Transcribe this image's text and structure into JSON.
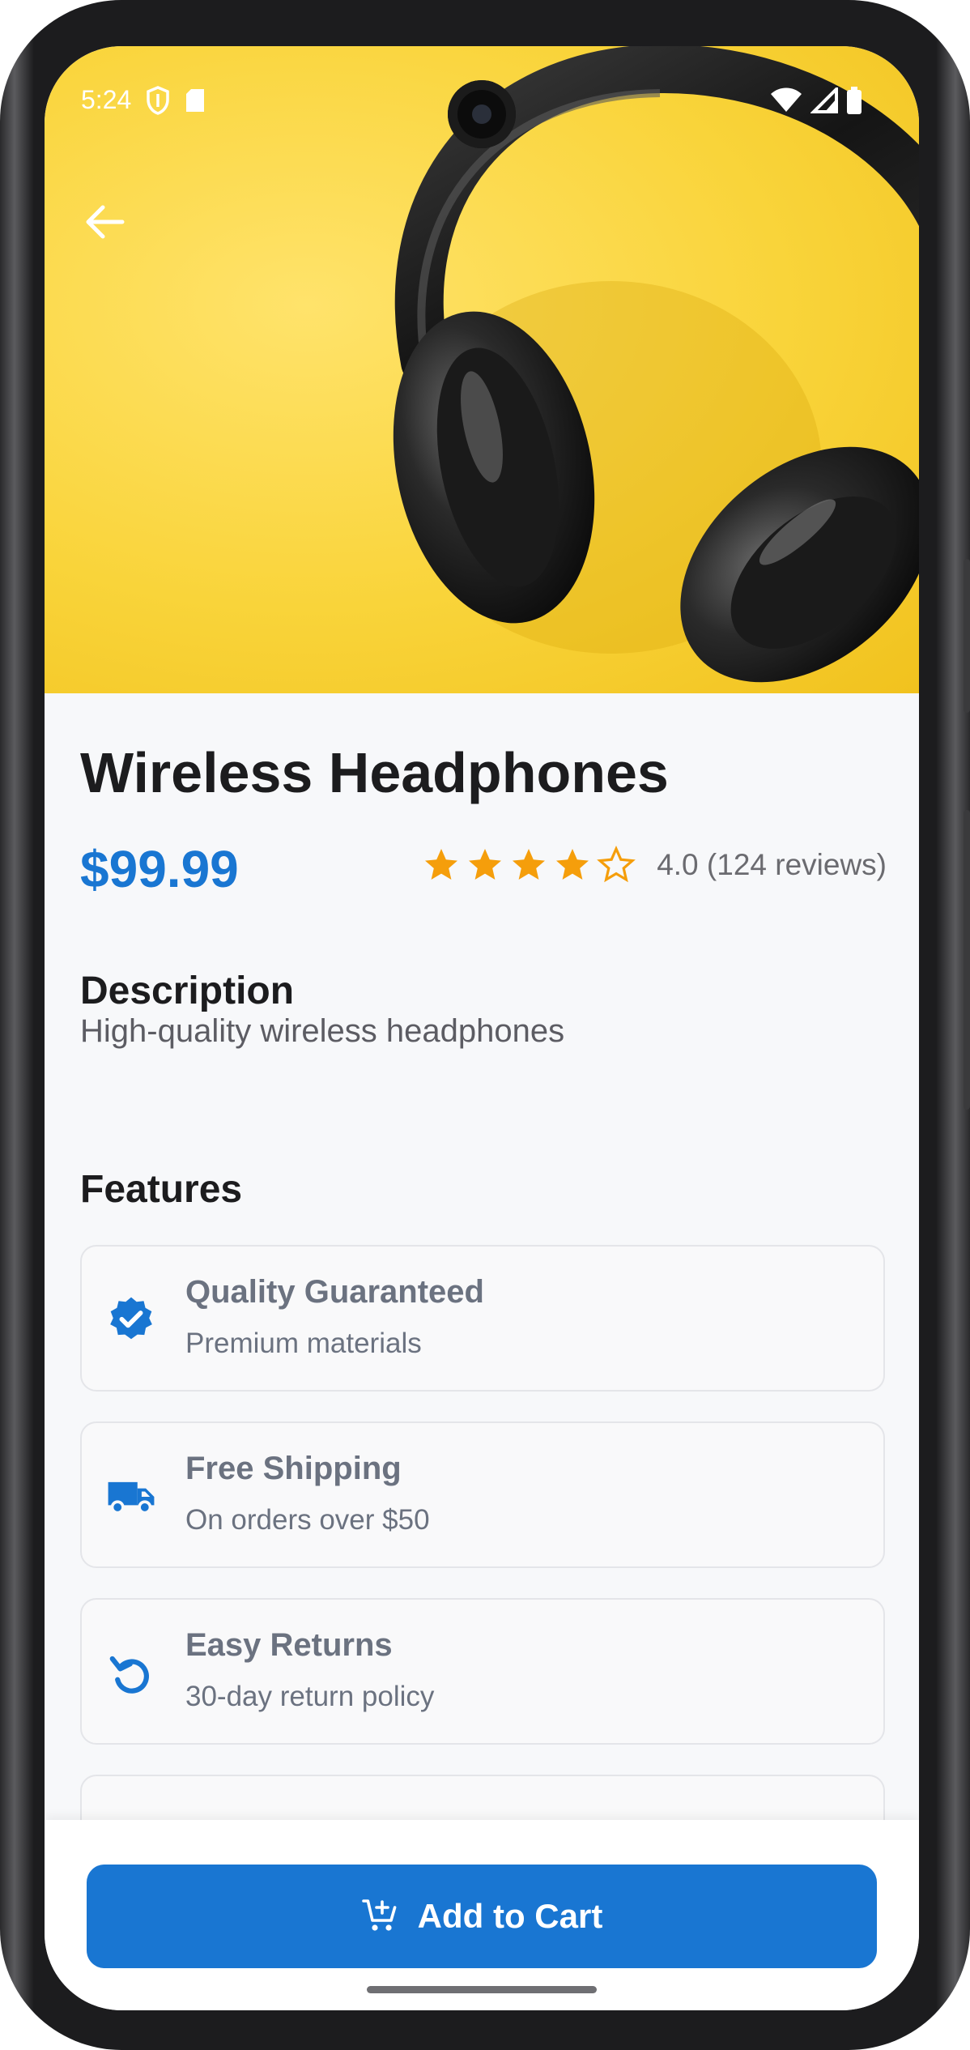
{
  "status_bar": {
    "time": "5:24"
  },
  "product": {
    "title": "Wireless Headphones",
    "price": "$99.99",
    "rating": 4.0,
    "rating_max": 5,
    "rating_text": "4.0 (124 reviews)"
  },
  "description": {
    "heading": "Description",
    "text": "High-quality wireless headphones"
  },
  "features": {
    "heading": "Features",
    "items": [
      {
        "icon": "verified-badge-icon",
        "title": "Quality Guaranteed",
        "subtitle": "Premium materials"
      },
      {
        "icon": "truck-icon",
        "title": "Free Shipping",
        "subtitle": "On orders over $50"
      },
      {
        "icon": "return-icon",
        "title": "Easy Returns",
        "subtitle": "30-day return policy"
      }
    ]
  },
  "actions": {
    "add_to_cart_label": "Add to Cart"
  },
  "colors": {
    "accent": "#1976d2",
    "star": "#f59e0b",
    "hero_bg": "#f9d43a"
  }
}
